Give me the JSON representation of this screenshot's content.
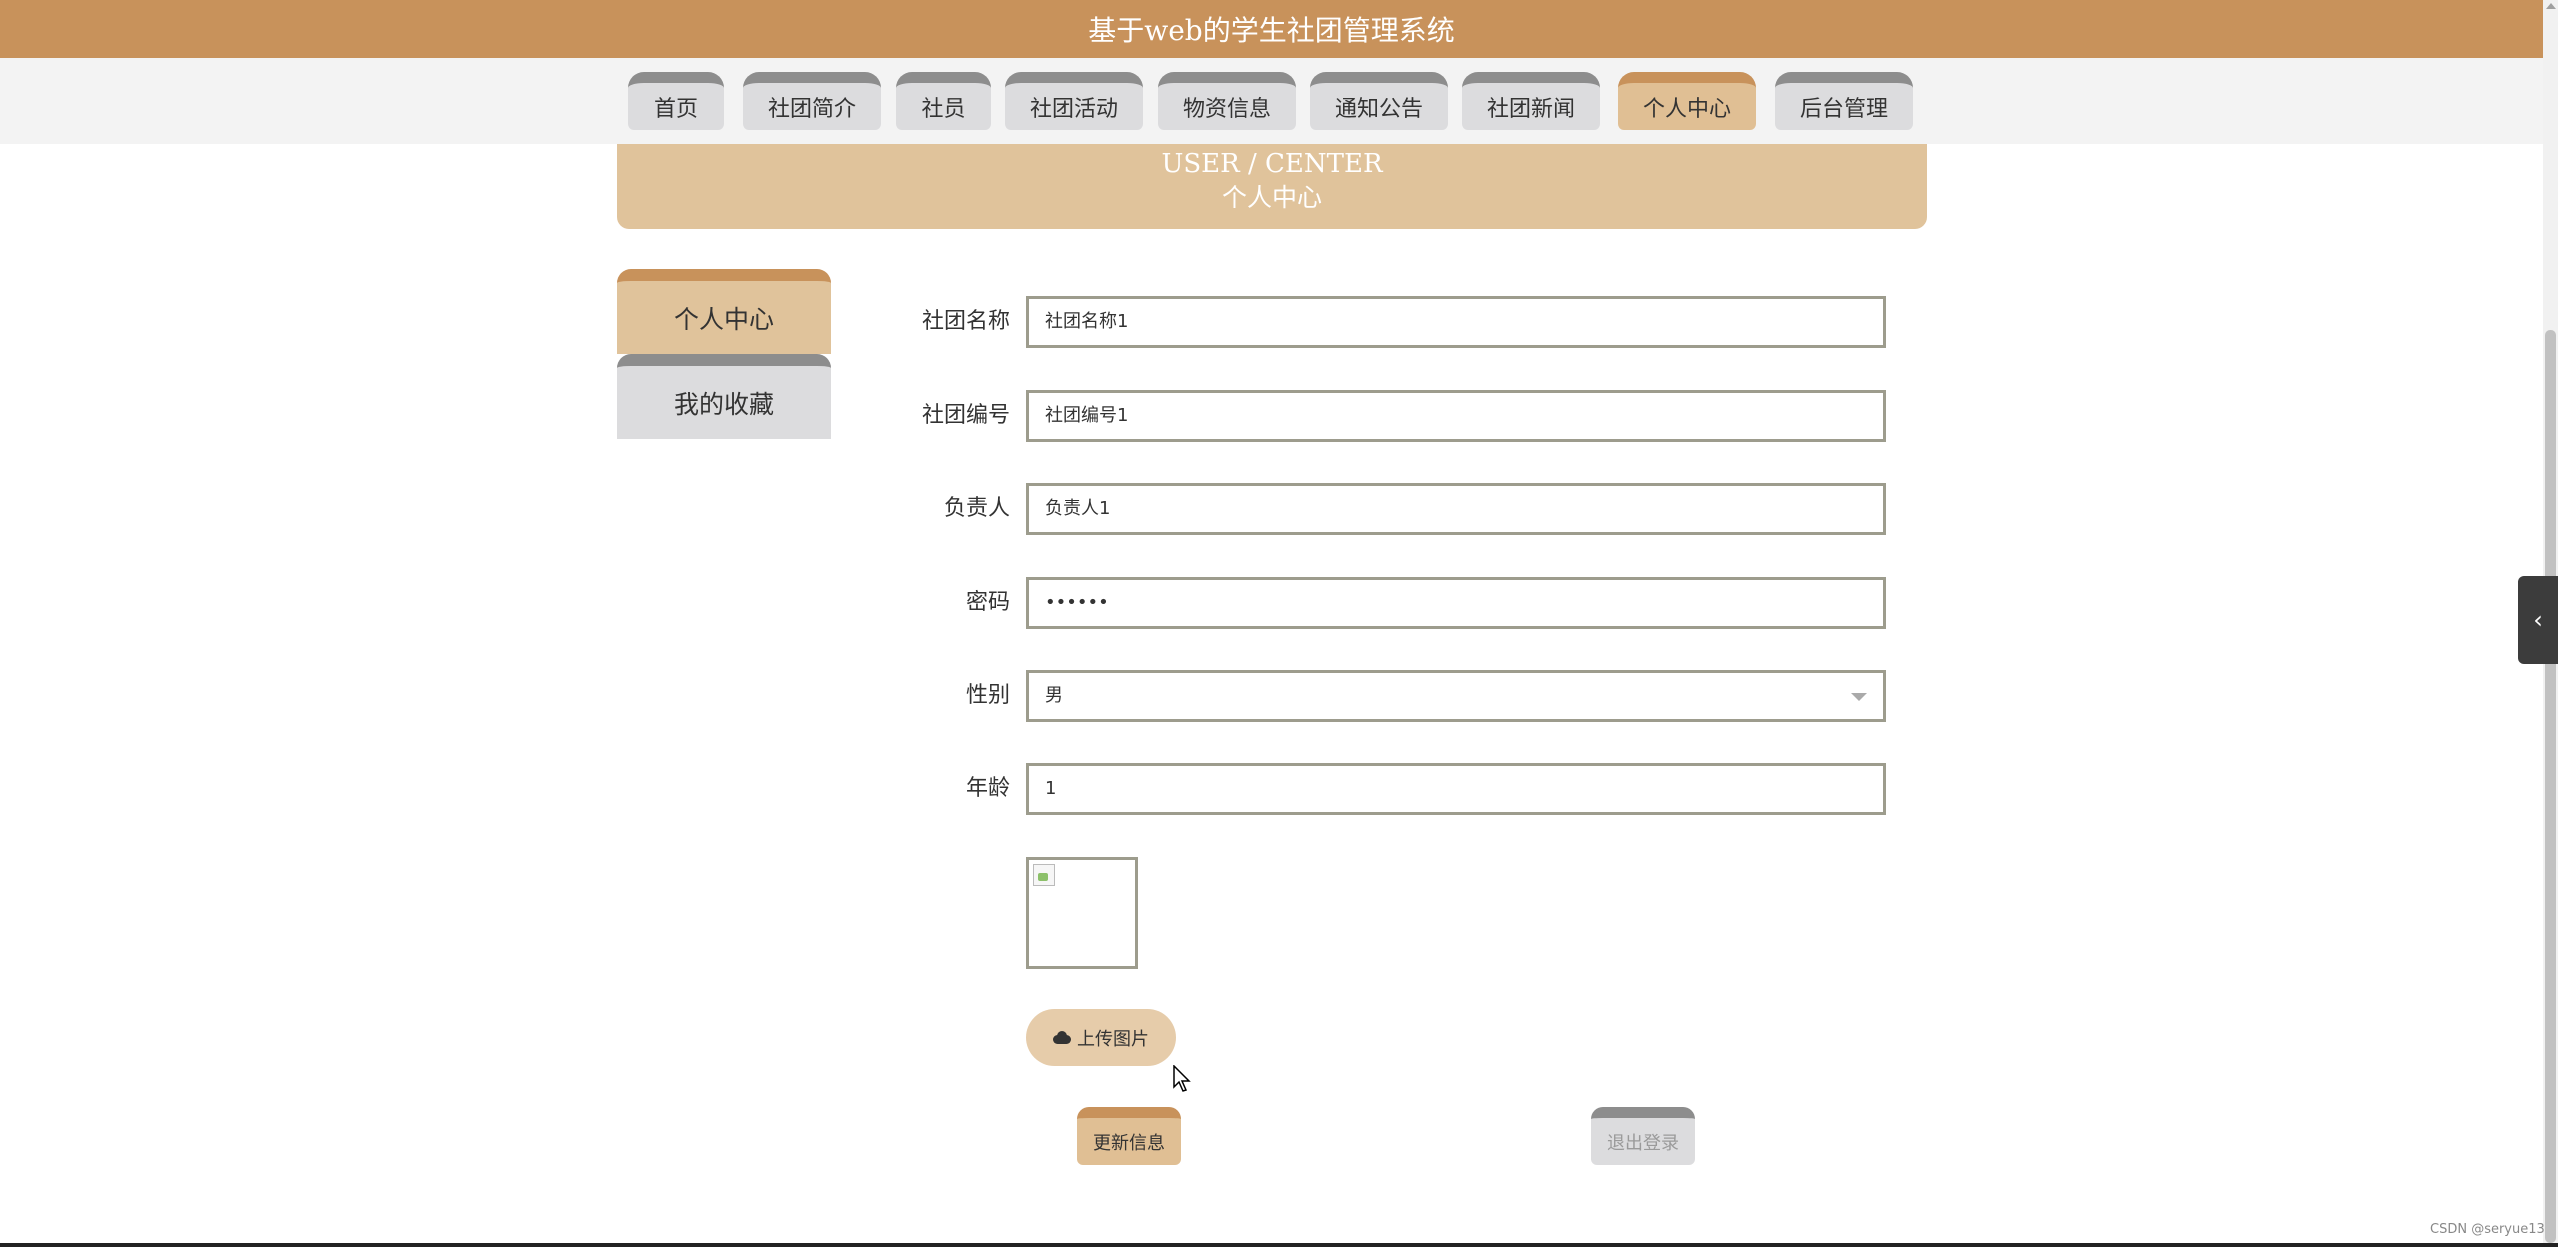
{
  "header": {
    "title": "基于web的学生社团管理系统"
  },
  "nav": {
    "items": [
      {
        "label": "首页"
      },
      {
        "label": "社团简介"
      },
      {
        "label": "社员"
      },
      {
        "label": "社团活动"
      },
      {
        "label": "物资信息"
      },
      {
        "label": "通知公告"
      },
      {
        "label": "社团新闻"
      },
      {
        "label": "个人中心"
      },
      {
        "label": "后台管理"
      }
    ],
    "active": "个人中心"
  },
  "section": {
    "title_en": "USER / CENTER",
    "title_cn": "个人中心"
  },
  "sidebar": {
    "items": [
      {
        "label": "个人中心"
      },
      {
        "label": "我的收藏"
      }
    ],
    "active": "个人中心"
  },
  "form": {
    "fields": [
      {
        "label": "社团名称",
        "value": "社团名称1"
      },
      {
        "label": "社团编号",
        "value": "社团编号1"
      },
      {
        "label": "负责人",
        "value": "负责人1"
      },
      {
        "label": "密码",
        "value": "••••••"
      },
      {
        "label": "性别",
        "value": "男"
      },
      {
        "label": "年龄",
        "value": "1"
      }
    ],
    "upload_label": "上传图片",
    "update_label": "更新信息",
    "logout_label": "退出登录"
  },
  "side_tab": {
    "icon": "chevron-left-icon",
    "glyph": "‹"
  },
  "watermark": "CSDN @seryue13",
  "colors": {
    "primary": "#c8925b",
    "secondary": "#e0c39b",
    "nav_inactive": "#dcdcde",
    "nav_inactive_top": "#8d8d8d"
  }
}
